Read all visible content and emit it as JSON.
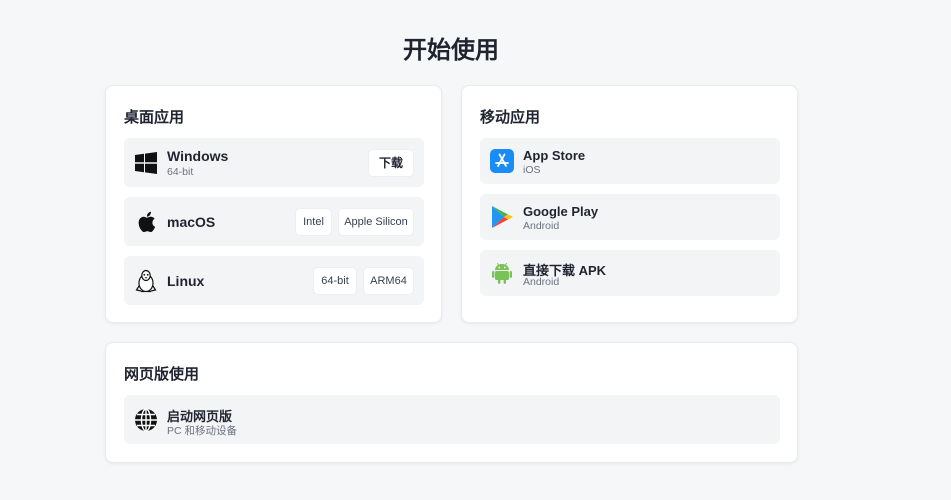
{
  "page": {
    "title": "开始使用"
  },
  "desktop": {
    "title": "桌面应用",
    "windows": {
      "name": "Windows",
      "sub": "64-bit",
      "button": "下载"
    },
    "macos": {
      "name": "macOS",
      "buttons": [
        "Intel",
        "Apple Silicon"
      ]
    },
    "linux": {
      "name": "Linux",
      "buttons": [
        "64-bit",
        "ARM64"
      ]
    }
  },
  "mobile": {
    "title": "移动应用",
    "appstore": {
      "name": "App Store",
      "sub": "iOS"
    },
    "googleplay": {
      "name": "Google Play",
      "sub": "Android"
    },
    "apk": {
      "name": "直接下载 APK",
      "sub": "Android"
    }
  },
  "web": {
    "title": "网页版使用",
    "launch": {
      "name": "启动网页版",
      "sub": "PC 和移动设备"
    }
  },
  "colors": {
    "background": "#f6f7f9",
    "card": "#ffffff",
    "row": "#f3f4f6",
    "appstore_blue": "#1a8cf5",
    "android_green": "#78c257"
  },
  "icons": {
    "windows": "windows-icon",
    "macos": "apple-icon",
    "linux": "linux-tux-icon",
    "appstore": "app-store-icon",
    "googleplay": "google-play-icon",
    "apk": "android-icon",
    "web": "globe-icon"
  }
}
